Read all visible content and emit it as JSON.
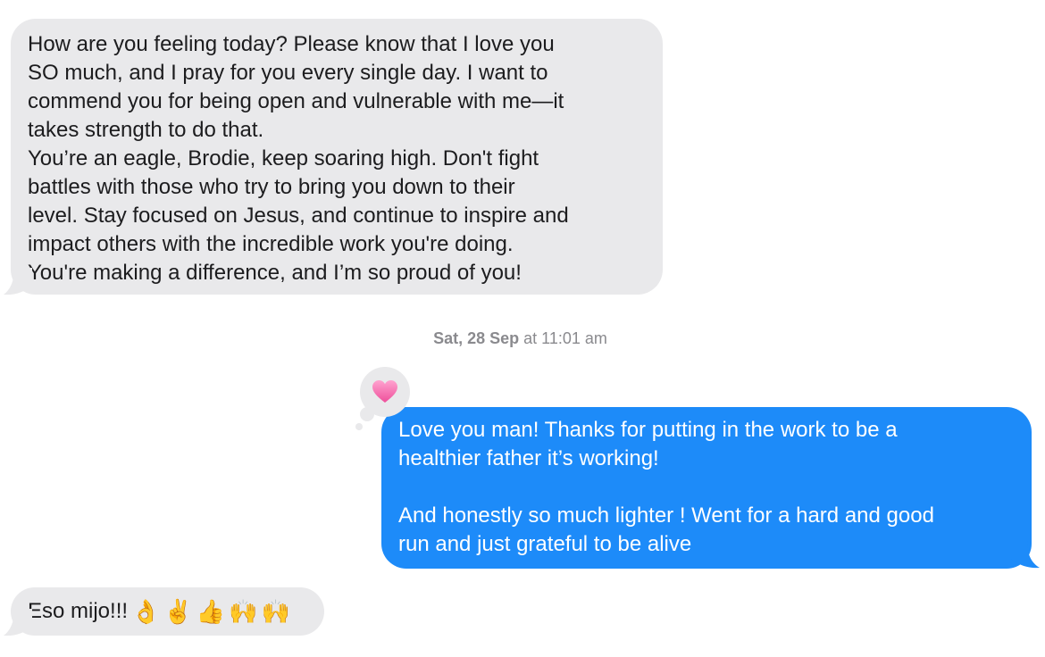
{
  "conversation": {
    "messages": [
      {
        "direction": "received",
        "text": "How are you feeling today? Please know that I love you\nSO much, and I pray for you every single day. I want to\ncommend you for being open and vulnerable with me—it\ntakes strength to do that.\nYou’re an eagle, Brodie, keep soaring high. Don't fight\nbattles with those who try to bring you down to their\nlevel. Stay focused on Jesus, and continue to inspire and\nimpact others with the incredible work you're doing.\nYou're making a difference, and I’m so proud of you!"
      },
      {
        "direction": "sent",
        "text": "Love you man! Thanks for putting in the work to be a\nhealthier father it’s working!\n\nAnd honestly so much lighter ! Went for a hard and good\nrun and just grateful to be alive",
        "tapback": "heart"
      },
      {
        "direction": "received",
        "text": "Eso mijo!!!",
        "emojis": [
          "👌",
          "✌️",
          "👍",
          "🙌",
          "🙌"
        ]
      }
    ],
    "timestamp": {
      "day": "Sat, 28 Sep",
      "time": "at 11:01 am"
    }
  },
  "colors": {
    "received_bubble": "#e9e9eb",
    "sent_bubble": "#1d8bf9",
    "timestamp_text": "#8a8a8e",
    "heart": "#f06aa7"
  }
}
